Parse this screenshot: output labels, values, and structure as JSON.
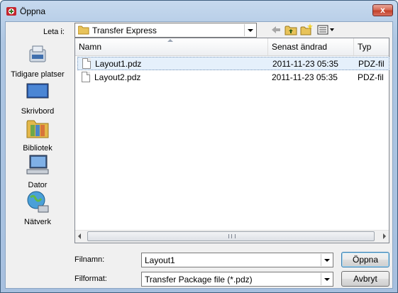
{
  "window": {
    "title": "Öppna",
    "close_glyph": "x"
  },
  "toolbar": {
    "look_in_label": "Leta i:",
    "look_in_value": "Transfer Express",
    "icons": [
      "back-arrow-icon",
      "up-folder-icon",
      "new-folder-icon",
      "view-menu-icon"
    ]
  },
  "places": [
    {
      "id": "recent",
      "label": "Tidigare platser",
      "icon": "recent-places-icon"
    },
    {
      "id": "desktop",
      "label": "Skrivbord",
      "icon": "desktop-icon"
    },
    {
      "id": "libraries",
      "label": "Bibliotek",
      "icon": "libraries-icon"
    },
    {
      "id": "computer",
      "label": "Dator",
      "icon": "computer-icon"
    },
    {
      "id": "network",
      "label": "Nätverk",
      "icon": "network-icon"
    }
  ],
  "list": {
    "columns": [
      "Namn",
      "Senast ändrad",
      "Typ"
    ],
    "rows": [
      {
        "name": "Layout1.pdz",
        "modified": "2011-11-23 05:35",
        "type": "PDZ-fil",
        "selected": true
      },
      {
        "name": "Layout2.pdz",
        "modified": "2011-11-23 05:35",
        "type": "PDZ-fil",
        "selected": false
      }
    ]
  },
  "footer": {
    "filename_label": "Filnamn:",
    "filename_value": "Layout1",
    "format_label": "Filformat:",
    "format_value": "Transfer Package file (*.pdz)",
    "open_label": "Öppna",
    "cancel_label": "Avbryt"
  },
  "colors": {
    "selection": "#e5f0fb",
    "titlebar": "#b9cfe8",
    "close": "#c2412a"
  }
}
